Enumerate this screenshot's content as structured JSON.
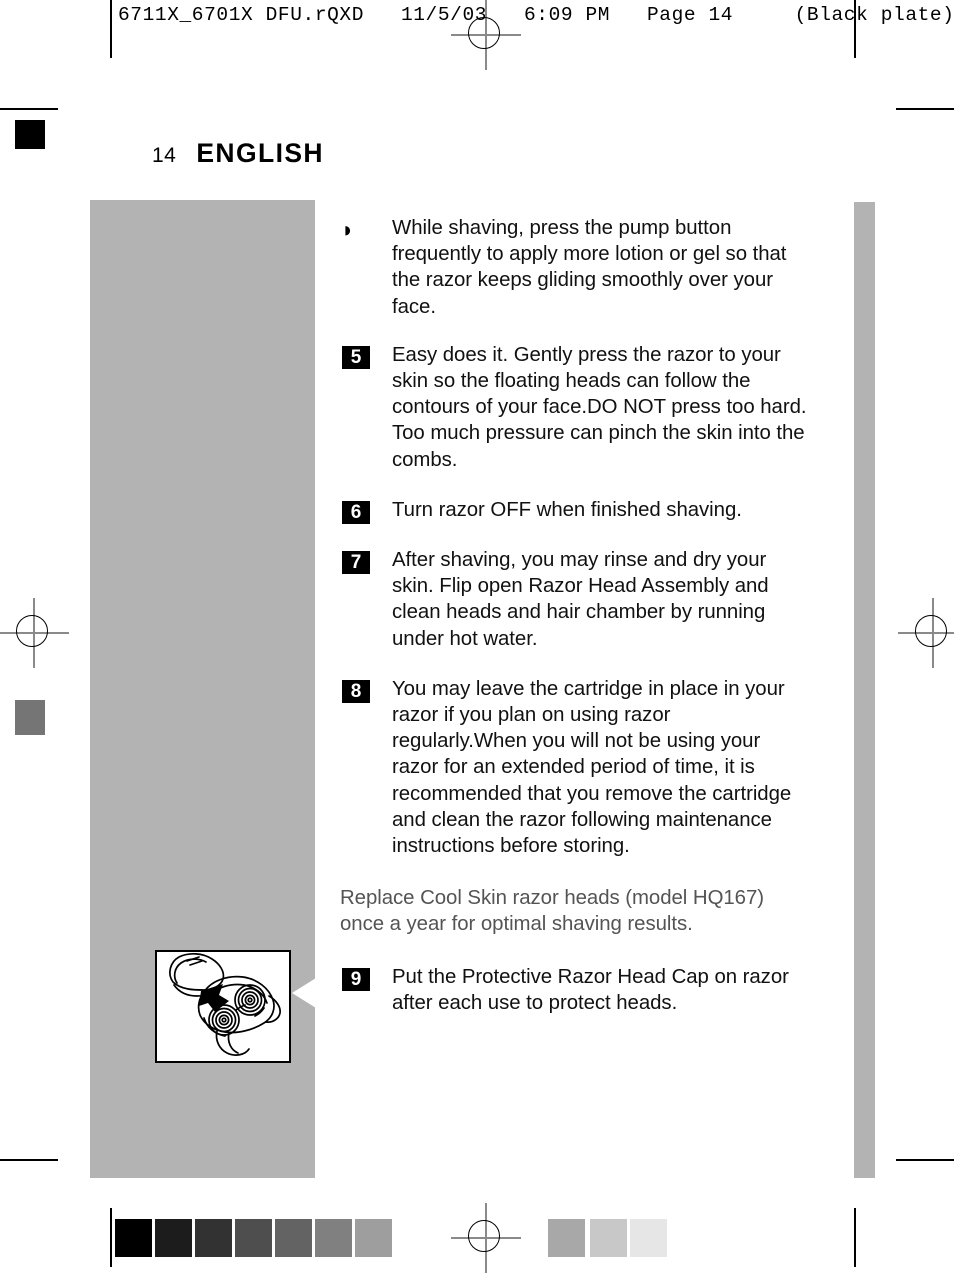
{
  "prepress": {
    "header": "6711X_6701X DFU.rQXD   11/5/03   6:09 PM   Page 14     (Black plate)",
    "registration_mark_name": "registration-target"
  },
  "page": {
    "number": "14",
    "title": "ENGLISH"
  },
  "colors": {
    "panel_gray": "#b3b3b3",
    "body_text": "#111111",
    "light_text": "#545454",
    "marker_bg": "#000000",
    "marker_fg": "#ffffff"
  },
  "content": {
    "blocks": [
      {
        "kind": "bullet",
        "marker": "◗",
        "text": "While shaving, press the pump button frequently to apply more lotion or gel so that the razor keeps gliding smoothly over your face."
      },
      {
        "kind": "number",
        "marker": "5",
        "text": "Easy does it. Gently press the razor to your skin so the floating heads can follow the contours of your face.DO NOT press too hard. Too much pressure can pinch the skin into the combs."
      },
      {
        "kind": "number",
        "marker": "6",
        "text": "Turn razor OFF when finished shaving."
      },
      {
        "kind": "number",
        "marker": "7",
        "text": "After shaving, you may rinse and dry your skin. Flip open Razor Head Assembly and clean heads and hair chamber by running under hot water."
      },
      {
        "kind": "number",
        "marker": "8",
        "text": "You may leave the cartridge in place in your razor if you plan on using razor regularly.When you will not be using your razor for an extended period of time, it is recommended that you remove the cartridge and clean the razor following maintenance instructions before storing."
      },
      {
        "kind": "plain",
        "marker": "",
        "text": "Replace Cool Skin razor heads (model HQ167) once a year for optimal shaving results."
      },
      {
        "kind": "number",
        "marker": "9",
        "text": "Put the Protective Razor Head Cap on razor after each use to protect heads."
      }
    ]
  },
  "figure": {
    "name": "razor-with-protective-cap-illustration",
    "caption": ""
  },
  "calibration": {
    "left_swatches": [
      "#000000",
      "#1c1c1c",
      "#323232",
      "#4e4e4e",
      "#636363",
      "#808080",
      "#9e9e9e"
    ],
    "right_swatches": [
      "#a8a8a8",
      "#c8c8c8",
      "#e6e6e6"
    ]
  }
}
